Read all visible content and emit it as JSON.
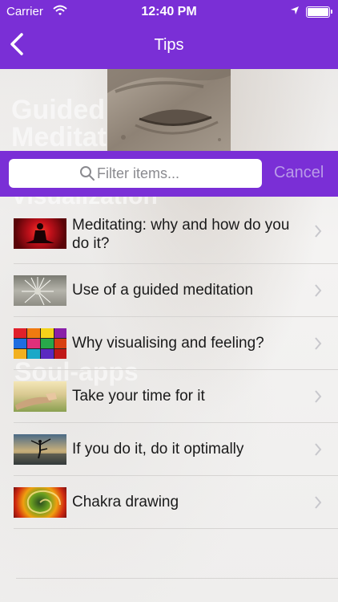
{
  "status_bar": {
    "carrier": "Carrier",
    "time": "12:40 PM",
    "wifi_icon": "wifi-icon",
    "location_icon": "location-arrow-icon",
    "battery_icon": "battery-icon"
  },
  "nav": {
    "title": "Tips",
    "back_icon": "chevron-left-icon"
  },
  "background_text": [
    "Guided",
    "Meditat",
    "Visualization",
    "Soul-apps"
  ],
  "search": {
    "placeholder": "Filter items...",
    "value": "",
    "cancel_label": "Cancel"
  },
  "list": {
    "items": [
      {
        "label": "Meditating: why and how do you do it?",
        "thumb_icon": "meditation-silhouette-thumbnail"
      },
      {
        "label": "Use of a guided meditation",
        "thumb_icon": "dandelion-thumbnail"
      },
      {
        "label": "Why visualising and feeling?",
        "thumb_icon": "color-pigments-thumbnail"
      },
      {
        "label": "Take your time for it",
        "thumb_icon": "relaxing-feet-thumbnail"
      },
      {
        "label": "If you do it, do it optimally",
        "thumb_icon": "yoga-pose-thumbnail"
      },
      {
        "label": "Chakra drawing",
        "thumb_icon": "chakra-swirl-thumbnail"
      }
    ]
  },
  "colors": {
    "brand": "#7a2fd6",
    "cancel_text": "#b99be8",
    "chevron": "#c7c7cc"
  }
}
